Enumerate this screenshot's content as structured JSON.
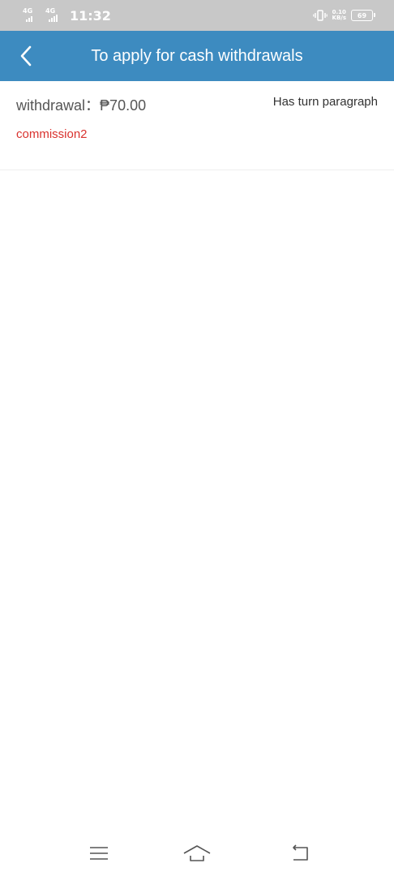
{
  "status_bar": {
    "network_1": "4G",
    "network_2": "4G",
    "time": "11:32",
    "speed_value": "0.10",
    "speed_unit": "KB/s",
    "battery_level": "69",
    "icons": [
      "signal-icon",
      "vibrate-icon",
      "battery-icon"
    ]
  },
  "header": {
    "back_icon": "chevron-left-icon",
    "title": "To apply for cash withdrawals",
    "background_color": "#3d8bc0"
  },
  "withdrawal": {
    "label": "withdrawal：",
    "amount": "₱70.00",
    "status": "Has turn paragraph",
    "type": "commission2",
    "type_color": "#d9322e"
  },
  "nav_bar": {
    "icons": [
      "menu-icon",
      "home-icon",
      "back-icon"
    ]
  }
}
